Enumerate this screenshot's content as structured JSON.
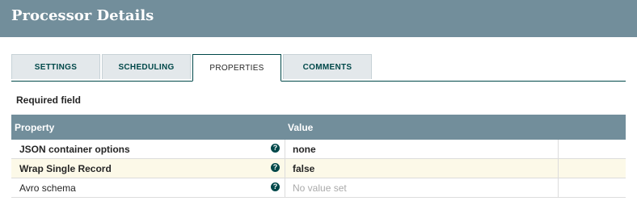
{
  "header": {
    "title": "Processor Details"
  },
  "tabs": [
    {
      "label": "SETTINGS"
    },
    {
      "label": "SCHEDULING"
    },
    {
      "label": "PROPERTIES"
    },
    {
      "label": "COMMENTS"
    }
  ],
  "required_label": "Required field",
  "table": {
    "columns": {
      "property": "Property",
      "value": "Value"
    },
    "rows": [
      {
        "name": "JSON container options",
        "value": "none"
      },
      {
        "name": "Wrap Single Record",
        "value": "false"
      },
      {
        "name": "Avro schema",
        "value": "No value set"
      }
    ]
  },
  "help_glyph": "?",
  "colors": {
    "header_bg": "#728e9b",
    "accent": "#004849",
    "highlight_row": "#fcf9e8"
  }
}
